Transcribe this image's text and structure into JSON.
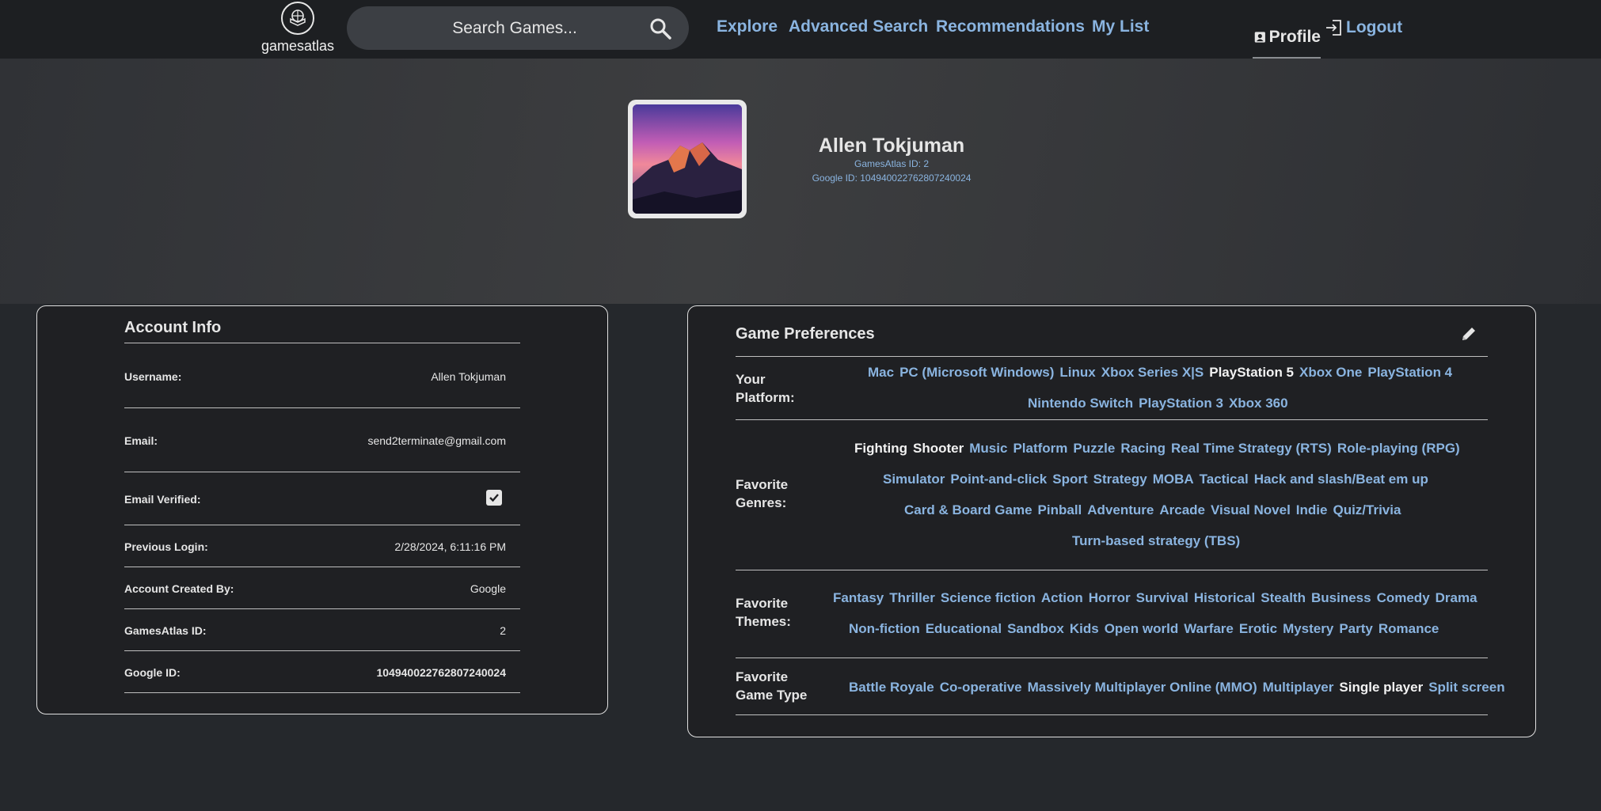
{
  "nav": {
    "logo_text": "gamesatlas",
    "search_placeholder": "Search Games...",
    "links": [
      "Explore",
      "Advanced Search",
      "Recommendations",
      "My List"
    ],
    "profile": "Profile",
    "logout": "Logout"
  },
  "hero": {
    "name": "Allen Tokjuman",
    "gamesatlas_id": "GamesAtlas ID: 2",
    "google_id": "Google ID: 104940022762807240024"
  },
  "account": {
    "title": "Account Info",
    "rows": [
      {
        "label": "Username:",
        "value": "Allen Tokjuman"
      },
      {
        "label": "Email:",
        "value": "send2terminate@gmail.com"
      },
      {
        "label": "Email Verified:",
        "value": ""
      },
      {
        "label": "Previous Login:",
        "value": "2/28/2024, 6:11:16 PM"
      },
      {
        "label": "Account Created By:",
        "value": "Google"
      },
      {
        "label": "GamesAtlas ID:",
        "value": "2"
      },
      {
        "label": "Google ID:",
        "value": "104940022762807240024"
      }
    ],
    "email_verified": true
  },
  "preferences": {
    "title": "Game Preferences",
    "platform_label_1": "Your",
    "platform_label_2": "Platform:",
    "platforms": [
      [
        "Mac",
        "PC (Microsoft Windows)",
        "Linux",
        "Xbox Series X|S",
        "PlayStation 5",
        "Xbox One",
        "PlayStation 4"
      ],
      [
        "Nintendo Switch",
        "PlayStation 3",
        "Xbox 360"
      ]
    ],
    "platforms_selected": [
      "PlayStation 5"
    ],
    "genres_label_1": "Favorite",
    "genres_label_2": "Genres:",
    "genres": [
      [
        "Fighting",
        "Shooter",
        "Music",
        "Platform",
        "Puzzle",
        "Racing",
        "Real Time Strategy (RTS)",
        "Role-playing (RPG)"
      ],
      [
        "Simulator",
        "Point-and-click",
        "Sport",
        "Strategy",
        "MOBA",
        "Tactical",
        "Hack and slash/Beat em up"
      ],
      [
        "Card & Board Game",
        "Pinball",
        "Adventure",
        "Arcade",
        "Visual Novel",
        "Indie",
        "Quiz/Trivia"
      ],
      [
        "Turn-based strategy (TBS)"
      ]
    ],
    "genres_selected": [
      "Fighting",
      "Shooter"
    ],
    "themes_label_1": "Favorite",
    "themes_label_2": "Themes:",
    "themes": [
      [
        "Fantasy",
        "Thriller",
        "Science fiction",
        "Action",
        "Horror",
        "Survival",
        "Historical",
        "Stealth",
        "Business",
        "Comedy",
        "Drama"
      ],
      [
        "Non-fiction",
        "Educational",
        "Sandbox",
        "Kids",
        "Open world",
        "Warfare",
        "Erotic",
        "Mystery",
        "Party",
        "Romance"
      ]
    ],
    "themes_selected": [],
    "gametype_label_1": "Favorite",
    "gametype_label_2": "Game Type",
    "gametypes": [
      [
        "Battle Royale",
        "Co-operative",
        "Massively Multiplayer Online (MMO)",
        "Multiplayer",
        "Single player",
        "Split screen"
      ]
    ],
    "gametypes_selected": [
      "Single player"
    ]
  }
}
